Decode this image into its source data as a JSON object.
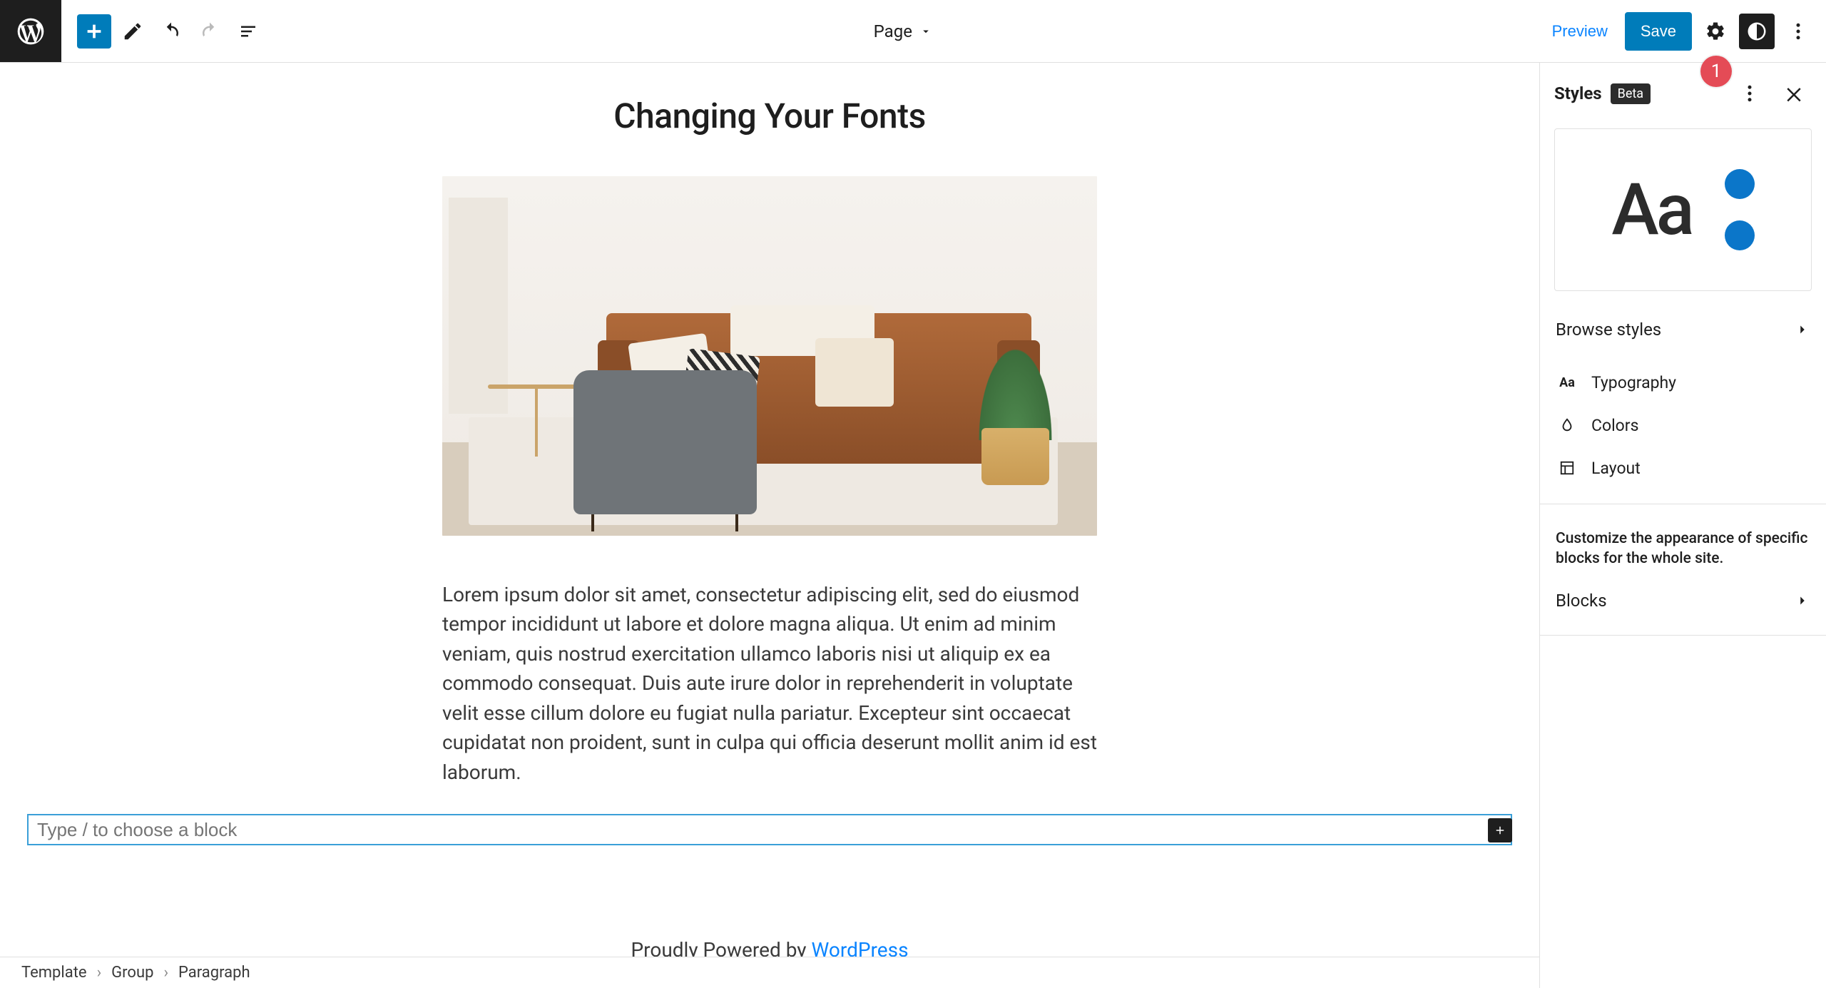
{
  "topbar": {
    "doc_label": "Page",
    "preview": "Preview",
    "save": "Save"
  },
  "content": {
    "title": "Changing Your Fonts",
    "paragraph": "Lorem ipsum dolor sit amet, consectetur adipiscing elit, sed do eiusmod tempor incididunt ut labore et dolore magna aliqua. Ut enim ad minim veniam, quis nostrud exercitation ullamco laboris nisi ut aliquip ex ea commodo consequat. Duis aute irure dolor in reprehenderit in voluptate velit esse cillum dolore eu fugiat nulla pariatur. Excepteur sint occaecat cupidatat non proident, sunt in culpa qui officia deserunt mollit anim id est laborum.",
    "appender_placeholder": "Type / to choose a block",
    "footer_prefix": "Proudly Powered by ",
    "footer_link": "WordPress"
  },
  "breadcrumb": [
    "Template",
    "Group",
    "Paragraph"
  ],
  "sidebar": {
    "title": "Styles",
    "badge": "Beta",
    "preview_sample": "Aa",
    "browse": "Browse styles",
    "items": [
      {
        "icon": "typography",
        "label": "Typography"
      },
      {
        "icon": "colors",
        "label": "Colors"
      },
      {
        "icon": "layout",
        "label": "Layout"
      }
    ],
    "help": "Customize the appearance of specific blocks for the whole site.",
    "blocks": "Blocks"
  },
  "annotation": {
    "number": "1"
  }
}
